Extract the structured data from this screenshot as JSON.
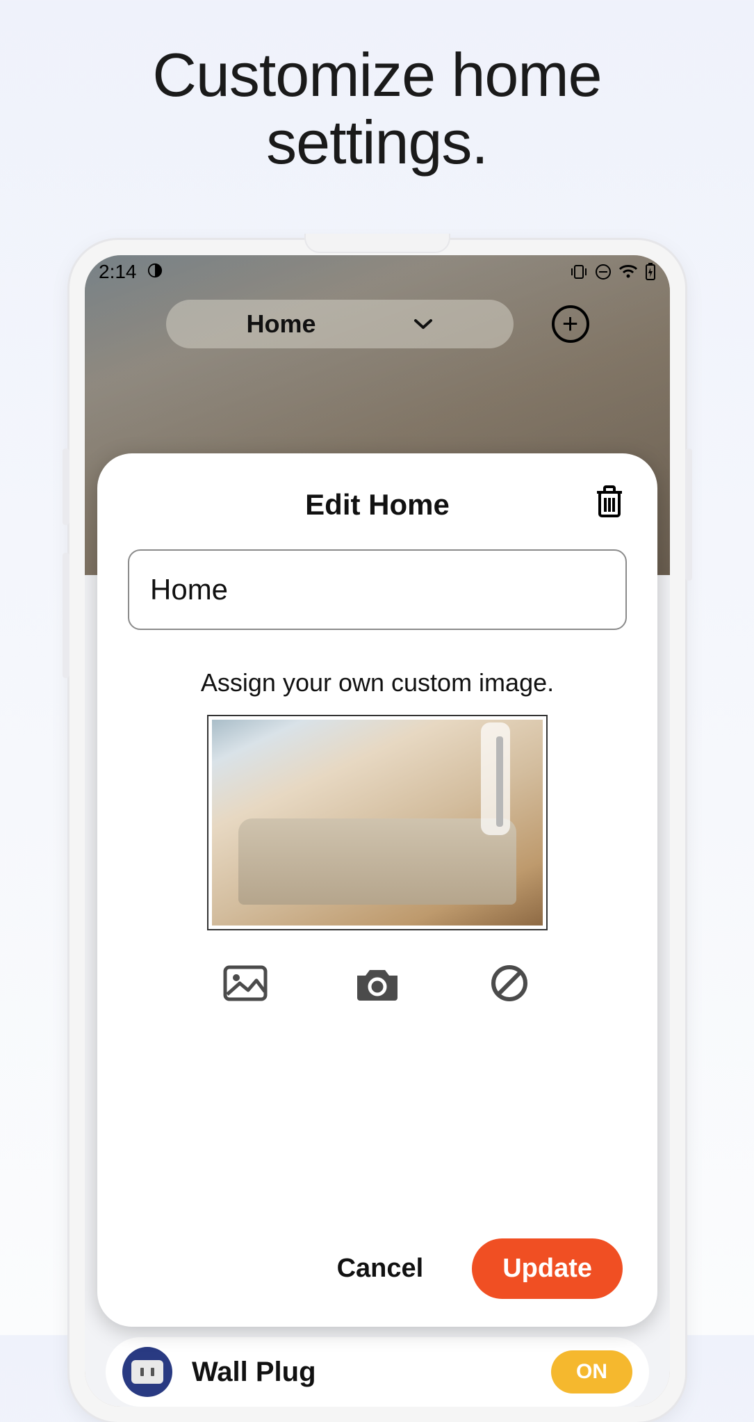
{
  "marketing": {
    "headline": "Customize home\nsettings."
  },
  "statusbar": {
    "time": "2:14"
  },
  "topbar": {
    "home_label": "Home",
    "add_label": "+"
  },
  "modal": {
    "title": "Edit Home",
    "name_value": "Home",
    "assign_text": "Assign your own custom image.",
    "cancel_label": "Cancel",
    "update_label": "Update"
  },
  "device_row": {
    "label": "Wall Plug",
    "state": "ON"
  },
  "colors": {
    "accent": "#f04f23",
    "on_pill": "#f5b82e"
  }
}
